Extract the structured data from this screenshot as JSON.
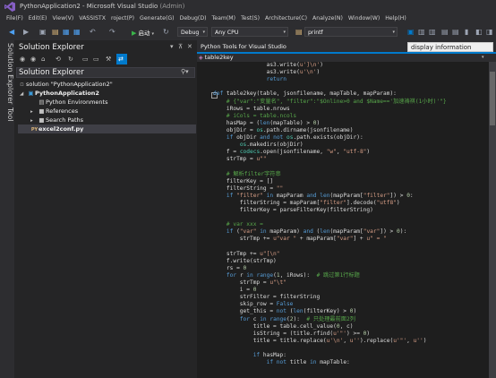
{
  "window": {
    "title": "PythonApplication2 - Microsoft Visual Studio",
    "admin_suffix": "(Admin)"
  },
  "menu": [
    "File(F)",
    "Edit(E)",
    "View(V)",
    "VASSISTX",
    "roject(P)",
    "Generate(G)",
    "Debug(D)",
    "Team(M)",
    "Test(S)",
    "Architecture(C)",
    "Analyze(N)",
    "Window(W)",
    "Help(H)"
  ],
  "toolbar": {
    "start_label": "启动",
    "config_value": "Debug",
    "platform_value": "Any CPU",
    "find_value": "printf"
  },
  "tooltip": "display information",
  "solution_explorer": {
    "title": "Solution Explorer",
    "search_label": "Solution Explorer",
    "vertical_tab": "Solution Explorer",
    "tool_tab": "Tool",
    "tree": [
      {
        "label": "solution \"PythonApplication2\"",
        "bold": false
      },
      {
        "label": "PythonApplication2",
        "bold": true
      },
      {
        "label": "Python Environments",
        "bold": false
      },
      {
        "label": "References",
        "bold": false
      },
      {
        "label": "Search Paths",
        "bold": false
      },
      {
        "label": "excel2conf.py",
        "bold": true
      }
    ]
  },
  "editor": {
    "tab_title": "Python Tools for Visual Studio",
    "nav_value": "table2key",
    "lines": [
      "                as3.write(u']\\n')",
      "                as3.write(u'\\n')",
      "                return",
      "",
      "def table2key(table, jsonfilename, mapTable, mapParam):",
      "    # {\"var\":\"变量名\", \"filter\":\"$Online>0 and $Name=='加速祷祺(1小时)'\"}",
      "    iRows = table.nrows",
      "    # iCols = table.ncols",
      "    hasMap = (len(mapTable) > 0)",
      "    objDir = os.path.dirname(jsonfilename)",
      "    if objDir and not os.path.exists(objDir):",
      "        os.makedirs(objDir)",
      "    f = codecs.open(jsonfilename, \"w\", \"utf-8\")",
      "    strTmp = u\"\"",
      "",
      "    # 解析filter字符串",
      "    filterKey = []",
      "    filterString = \"\"",
      "    if \"filter\" in mapParam and len(mapParam[\"filter\"]) > 0:",
      "        filterString = mapParam[\"filter\"].decode(\"utf8\")",
      "        filterKey = parseFilterKey(filterString)",
      "",
      "    # var xxx =",
      "    if (\"var\" in mapParam) and (len(mapParam[\"var\"]) > 0):",
      "        strTmp += u\"var \" + mapParam[\"var\"] + u\" = \"",
      "",
      "    strTmp += u\"[\\n\"",
      "    f.write(strTmp)",
      "    rs = 0",
      "    for r in range(1, iRows):  # 跳过第1行标题",
      "        strTmp = u\"\\t\"",
      "        i = 0",
      "        strFilter = filterString",
      "        skip_row = False",
      "        get_this = not (len(filterKey) > 0)",
      "        for c in range(2):  # 只处理最前面2列",
      "            title = table.cell_value(0, c)",
      "            isString = (title.rfind(u'\"') >= 0)",
      "            title = title.replace(u'\\n', u'').replace(u'\"', u'')",
      "",
      "            if hasMap:",
      "                if not title in mapTable:"
    ]
  }
}
